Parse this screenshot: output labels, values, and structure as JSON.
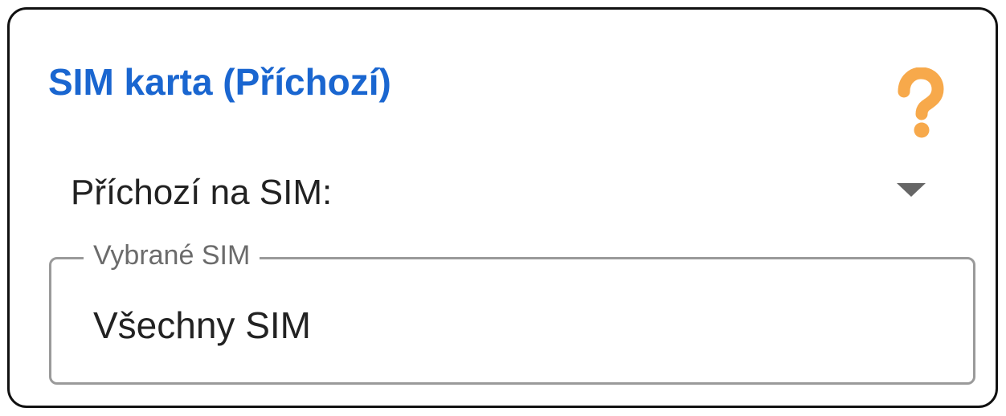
{
  "card": {
    "title": "SIM karta (Příchozí)",
    "help_icon": "question-mark-icon",
    "colors": {
      "title": "#1a66d0",
      "help_icon": "#f7a94b"
    }
  },
  "incoming": {
    "label": "Příchozí na SIM:",
    "dropdown_icon": "caret-down-icon"
  },
  "selected_sim": {
    "legend": "Vybrané SIM",
    "value": "Všechny SIM"
  }
}
